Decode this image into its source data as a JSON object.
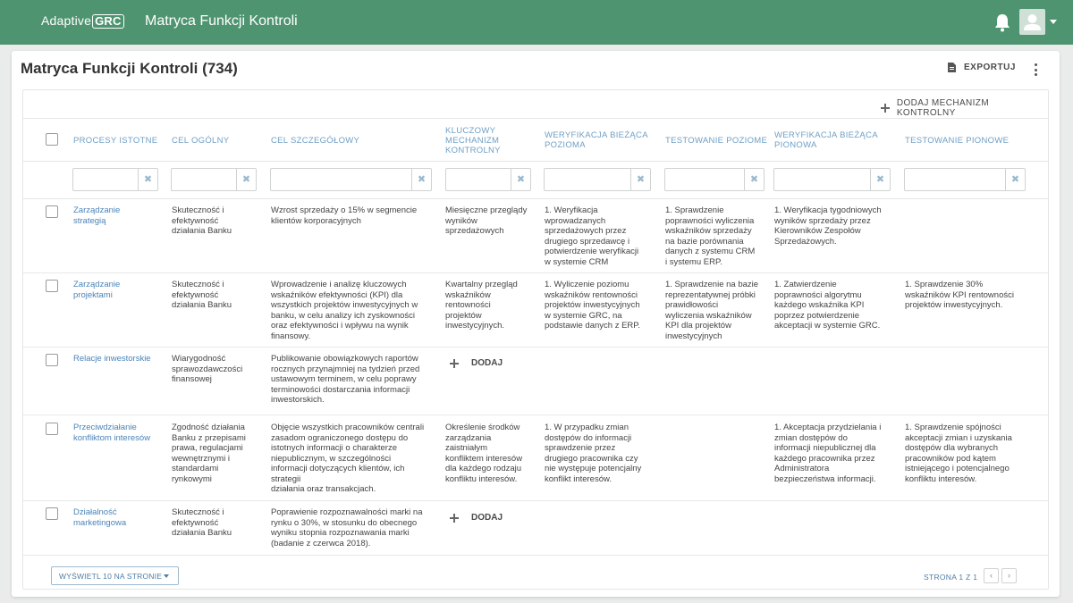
{
  "app": {
    "logo_text": "Adaptive",
    "logo_badge": "GRC",
    "title": "Matryca Funkcji Kontroli"
  },
  "page": {
    "title": "Matryca Funkcji Kontroli (734)",
    "export_label": "EXPORTUJ",
    "add_mechanism_label": "DODAJ MECHANIZM KONTROLNY",
    "add_label": "DODAJ"
  },
  "table": {
    "headers": {
      "c1": "PROCESY ISTOTNE",
      "c2": "CEL OGÓLNY",
      "c3": "CEL SZCZEGÓŁOWY",
      "c4": "KLUCZOWY\nMECHANIZM\nKONTROLNY",
      "c5": "WERYFIKACJA BIEŻĄCA\nPOZIOMA",
      "c6": "TESTOWANIE POZIOME",
      "c7": "WERYFIKACJA BIEŻĄCA\nPIONOWA",
      "c8": "TESTOWANIE PIONOWE"
    },
    "filters": {
      "c1": "",
      "c2": "",
      "c3": "",
      "c4": "",
      "c5": "",
      "c6": "",
      "c7": "",
      "c8": ""
    },
    "rows": [
      {
        "c1": "Zarządzanie\nstrategią",
        "c2": "Skuteczność i\nefektywność\ndziałania Banku",
        "c3": "Wzrost sprzedaży o 15% w segmencie\nklientów korporacyjnych",
        "c4": "Miesięczne przeglądy\nwyników\nsprzedażowych",
        "c5": "1. Weryfikacja\nwprowadzanych\nsprzedażowych przez\ndrugiego sprzedawcę i\npotwierdzenie weryfikacji\nw systemie CRM",
        "c6": "1. Sprawdzenie\npoprawności wyliczenia\nwskaźników sprzedaży\nna bazie porównania\ndanych z systemu CRM\ni systemu ERP.",
        "c7": "1. Weryfikacja tygodniowych\nwyników sprzedaży przez\nKierowników Zespołów\nSprzedażowych.",
        "c8": ""
      },
      {
        "c1": "Zarządzanie\nprojektami",
        "c2": "Skuteczność i\nefektywność\ndziałania Banku",
        "c3": "Wprowadzenie i analizę kluczowych\nwskaźników efektywności (KPI) dla\nwszystkich projektów inwestycyjnych w\nbanku, w celu analizy ich zyskowności\noraz efektywności i wpływu na wynik\nfinansowy.",
        "c4": "Kwartalny przegląd\nwskaźników\nrentowności\nprojektów\ninwestycyjnych.",
        "c5": "1. Wyliczenie poziomu\nwskaźników rentowności\nprojektów inwestycyjnych\nw systemie GRC, na\npodstawie danych z ERP.",
        "c6": "1. Sprawdzenie na bazie\nreprezentatywnej próbki\nprawidłowości\nwyliczenia wskaźników\nKPI dla projektów\ninwestycyjnych",
        "c7": "1. Zatwierdzenie\npoprawności algorytmu\nkażdego wskaźnika KPI\npoprzez potwierdzenie\nakceptacji w systemie GRC.",
        "c8": "1. Sprawdzenie 30%\nwskaźników KPI rentowności\nprojektów inwestycyjnych."
      },
      {
        "c1": "Relacje inwestorskie",
        "c2": "Wiarygodność\nsprawozdawczości\nfinansowej",
        "c3": "Publikowanie obowiązkowych raportów\nrocznych przynajmniej na tydzień przed\nustawowym terminem, w celu poprawy\nterminowości dostarczania informacji\ninwestorskich.",
        "c4": "",
        "c5": "",
        "c6": "",
        "c7": "",
        "c8": ""
      },
      {
        "c1": "Przeciwdziałanie\nkonfliktom interesów",
        "c2": "Zgodność działania\nBanku z przepisami\nprawa, regulacjami\nwewnętrznymi i\nstandardami\nrynkowymi",
        "c3": "Objęcie wszystkich pracowników centrali\nzasadom ograniczonego dostępu do\nistotnych informacji o charakterze\nniepublicznym, w szczególności\ninformacji dotyczących klientów, ich\nstrategii\ndziałania oraz transakcjach.",
        "c4": "Określenie środków\nzarządzania\nzaistniałym\nkonfliktem interesów\ndla każdego rodzaju\nkonfliktu interesów.",
        "c5": "1. W przypadku zmian\ndostępów do informacji\nsprawdzenie przez\ndrugiego pracownika czy\nnie występuje potencjalny\nkonflikt interesów.",
        "c6": "",
        "c7": "1. Akceptacja przydzielania i\nzmian dostępów do\ninformacji niepublicznej dla\nkażdego pracownika przez\nAdministratora\nbezpieczeństwa informacji.",
        "c8": "1. Sprawdzenie spójności\nakceptacji zmian i uzyskania\ndostępów dla wybranych\npracowników pod kątem\nistniejącego i potencjalnego\nkonfliktu interesów."
      },
      {
        "c1": "Działalność\nmarketingowa",
        "c2": "Skuteczność i\nefektywność\ndziałania Banku",
        "c3": "Poprawienie rozpoznawalności marki na\nrynku o 30%, w stosunku do obecnego\nwyniku stopnia rozpoznawania marki\n(badanie z czerwca 2018).",
        "c4": "",
        "c5": "",
        "c6": "",
        "c7": "",
        "c8": ""
      }
    ]
  },
  "footer": {
    "per_page_label": "WYŚWIETL 10 NA STRONIE",
    "page_info": "STRONA 1 Z 1",
    "prev": "‹",
    "next": "›"
  },
  "icons": {
    "filter_clear": "✖"
  },
  "colors": {
    "topbar": "#4f9470",
    "header_text": "#6f9fc4",
    "link": "#4a84b8"
  }
}
